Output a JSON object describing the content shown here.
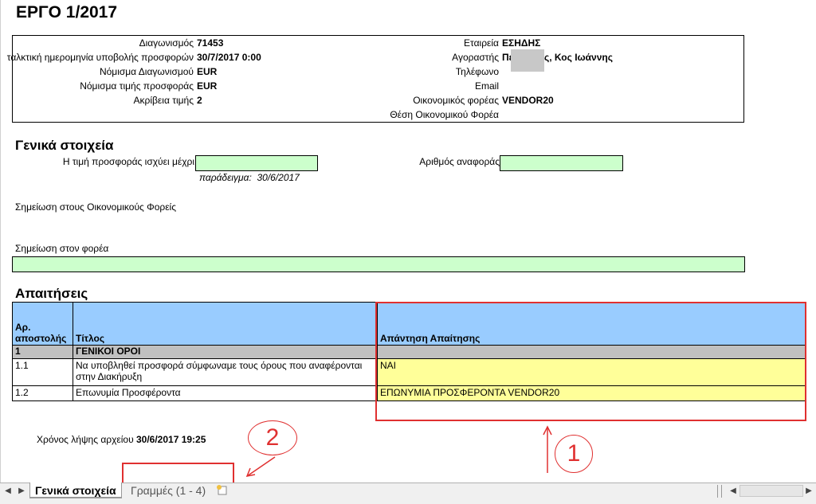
{
  "title": "ΕΡΓΟ 1/2017",
  "info": {
    "tender_label": "Διαγωνισμός",
    "tender_value": "71453",
    "deadline_label": "ταλκτική ημερομηνία υποβολής προσφορών",
    "deadline_value": "30/7/2017 0:00",
    "tender_currency_label": "Νόμισμα Διαγωνισμού",
    "tender_currency_value": "EUR",
    "offer_currency_label": "Νόμισμα τιμής προσφοράς",
    "offer_currency_value": "EUR",
    "price_precision_label": "Ακρίβεια τιμής",
    "price_precision_value": "2",
    "company_label": "Εταιρεία",
    "company_value": "ΕΣΗΔΗΣ",
    "buyer_label": "Αγοραστής",
    "buyer_value_prefix": "Πε",
    "buyer_value_suffix": "ς, Κος Ιωάννης",
    "phone_label": "Τηλέφωνο",
    "email_label": "Email",
    "operator_label": "Οικονομικός φορέας",
    "operator_value": "VENDOR20",
    "operator_position_label": "Θέση Οικονομικού Φορέα"
  },
  "general": {
    "heading": "Γενικά στοιχεία",
    "valid_until_label": "Η τιμή προσφοράς ισχύει μέχρι",
    "valid_until_value": "",
    "example_label": "παράδειγμα:",
    "example_value": "30/6/2017",
    "reference_label": "Αριθμός αναφοράς",
    "reference_value": "",
    "note_to_operators_label": "Σημείωση στους Οικονομικούς Φορείς",
    "note_to_body_label": "Σημείωση στον φορέα",
    "note_to_body_value": ""
  },
  "requirements": {
    "heading": "Απαιτήσεις",
    "col_no": "Αρ. αποστολής",
    "col_title": "Τίτλος",
    "col_answer": "Απάντηση Απαίτησης",
    "section_no": "1",
    "section_title": "ΓΕΝΙΚΟΙ ΟΡΟΙ",
    "rows": [
      {
        "no": "1.1",
        "title": "Να υποβληθεί προσφορά σύμφωναμε τους όρους που αναφέρονται στην Διακήρυξη",
        "answer": "ΝΑΙ"
      },
      {
        "no": "1.2",
        "title": "Επωνυμία Προσφέροντα",
        "answer": "ΕΠΩΝΥΜΙΑ ΠΡΟΣΦΕΡΟΝΤΑ VENDOR20"
      }
    ]
  },
  "file_time_label": "Χρόνος λήψης αρχείου",
  "file_time_value": "30/6/2017 19:25",
  "annotations": {
    "one": "1",
    "two": "2"
  },
  "tabs": {
    "active": "Γενικά στοιχεία",
    "inactive": "Γραμμές (1 - 4)"
  },
  "colors": {
    "header_blue": "#99ccff",
    "input_green": "#ccffcc",
    "answer_yellow": "#ffff99",
    "annotation_red": "#e03030"
  }
}
